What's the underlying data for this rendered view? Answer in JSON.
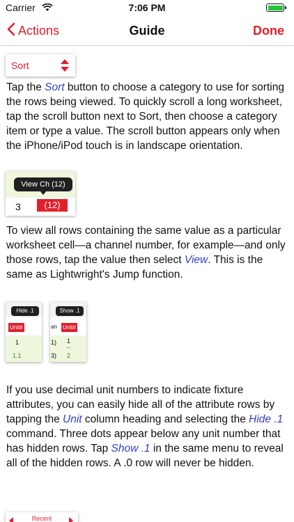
{
  "status": {
    "carrier": "Carrier",
    "time": "7:06 PM",
    "wifi_icon": "wifi-icon",
    "battery_icon": "battery-icon",
    "battery_color": "#24c43a"
  },
  "nav": {
    "back_label": "Actions",
    "title": "Guide",
    "done_label": "Done",
    "accent": "#e0202c"
  },
  "sort_thumb": {
    "label": "Sort"
  },
  "para1": {
    "a": "Tap the ",
    "em": "Sort",
    "b": " button to choose a category to use for sorting the rows being viewed. To quickly scroll a long worksheet, tap the scroll button next to Sort, then choose a category item or type a value. The scroll button appears only when the iPhone/iPod touch is in landscape orientation."
  },
  "view_thumb": {
    "menu_label": "View Ch (12)",
    "cell_left": "3",
    "cell_selected": "(12)"
  },
  "para2": {
    "a": "To view all rows containing the same value as a particular worksheet cell—a channel number, for example—and only those rows, tap the value then select ",
    "em": "View",
    "b": ". This is the same as Lightwright's Jump function."
  },
  "hide_thumb": {
    "menu_label": "Hide .1",
    "header": "Unit#",
    "row1": "1",
    "row2": "1.1"
  },
  "show_thumb": {
    "menu_label": "Show .1",
    "header_prefix": "an",
    "header": "Unit#",
    "row1_prefix": "1)",
    "row1": "1",
    "row2_prefix": "3)",
    "row2": "2"
  },
  "para3": {
    "a": "If you use decimal unit numbers to indicate fixture attributes, you can easily hide all of the attribute rows by tapping the ",
    "em1": "Unit",
    "b": " column heading and selecting the ",
    "em2": "Hide .1",
    "c": " command. Three dots appear below any unit number that has hidden rows. Tap ",
    "em3": "Show .1",
    "d": " in the same menu to reveal all of the hidden rows. A .0 row will never be hidden."
  },
  "recent_thumb": {
    "label": "Recent"
  }
}
